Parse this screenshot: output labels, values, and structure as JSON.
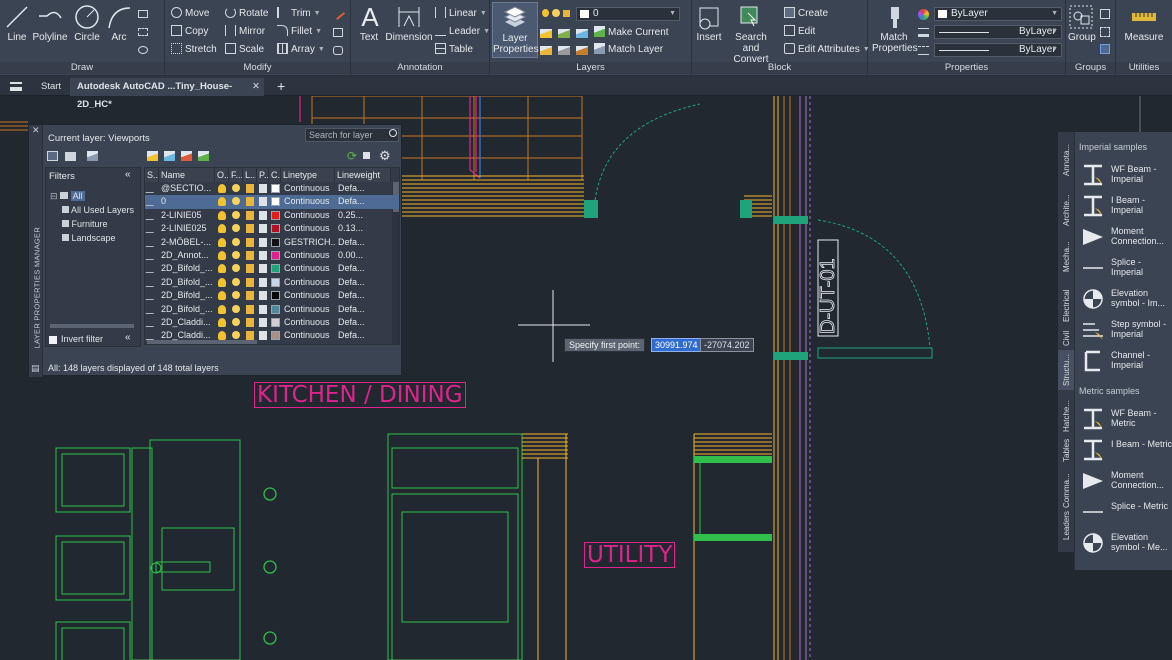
{
  "ribbon": {
    "draw": {
      "label": "Draw",
      "tools": [
        "Line",
        "Polyline",
        "Circle",
        "Arc"
      ]
    },
    "modify": {
      "label": "Modify",
      "tools": [
        "Move",
        "Rotate",
        "Trim",
        "Copy",
        "Mirror",
        "Fillet",
        "Stretch",
        "Scale",
        "Array"
      ]
    },
    "annotation": {
      "label": "Annotation",
      "big": [
        "Text",
        "Dimension"
      ],
      "tools": [
        "Linear",
        "Leader",
        "Table"
      ]
    },
    "layers": {
      "label": "Layers",
      "big": "Layer Properties",
      "combo_value": "0",
      "tools": [
        "Make Current",
        "Match Layer"
      ]
    },
    "block": {
      "label": "Block",
      "big": [
        "Insert",
        "Search and Convert"
      ],
      "tools": [
        "Create",
        "Edit",
        "Edit Attributes"
      ]
    },
    "properties": {
      "label": "Properties",
      "big": "Match Properties",
      "combos": [
        "ByLayer",
        "ByLayer",
        "ByLayer"
      ]
    },
    "groups": {
      "label": "Groups",
      "big": "Group"
    },
    "utilities": {
      "label": "Utilities",
      "big": "Measure"
    }
  },
  "tabs": [
    "Start",
    "Autodesk AutoCAD ...Tiny_House-2D_HC*"
  ],
  "layer_manager": {
    "side_title": "LAYER PROPERTIES MANAGER",
    "current_layer": "Current layer: Viewports",
    "search_placeholder": "Search for layer",
    "filters_title": "Filters",
    "tree": [
      "All",
      "All Used Layers",
      "Furniture",
      "Landscape"
    ],
    "invert_filter": "Invert filter",
    "status": "All: 148 layers displayed of 148 total layers",
    "columns": [
      "S...",
      "Name",
      "O...",
      "F...",
      "L...",
      "P...",
      "C...",
      "Linetype",
      "Lineweight"
    ],
    "rows": [
      {
        "name": "@SECTIO...",
        "color": "#ffffff",
        "linetype": "Continuous",
        "lineweight": "Defa..."
      },
      {
        "name": "0",
        "color": "#ffffff",
        "linetype": "Continuous",
        "lineweight": "Defa..."
      },
      {
        "name": "2-LINIE05",
        "color": "#e61c1c",
        "linetype": "Continuous",
        "lineweight": "0.25..."
      },
      {
        "name": "2-LINIE025",
        "color": "#b01020",
        "linetype": "Continuous",
        "lineweight": "0.13..."
      },
      {
        "name": "2-MÖBEL-...",
        "color": "#111111",
        "linetype": "GESTRICH...",
        "lineweight": "Defa..."
      },
      {
        "name": "2D_Annot...",
        "color": "#e0238c",
        "linetype": "Continuous",
        "lineweight": "0.00..."
      },
      {
        "name": "2D_Bifold_...",
        "color": "#1fa37a",
        "linetype": "Continuous",
        "lineweight": "Defa..."
      },
      {
        "name": "2D_Bifold_...",
        "color": "#c8d8e8",
        "linetype": "Continuous",
        "lineweight": "Defa..."
      },
      {
        "name": "2D_Bifold_...",
        "color": "#0a0a0a",
        "linetype": "Continuous",
        "lineweight": "Defa..."
      },
      {
        "name": "2D_Bifold_...",
        "color": "#4c8a9c",
        "linetype": "Continuous",
        "lineweight": "Defa..."
      },
      {
        "name": "2D_Claddi...",
        "color": "#d0d0d0",
        "linetype": "Continuous",
        "lineweight": "Defa..."
      },
      {
        "name": "2D_Claddi...",
        "color": "#a89088",
        "linetype": "Continuous",
        "lineweight": "Defa..."
      }
    ]
  },
  "palette": {
    "tabs": [
      "Annota...",
      "Archite...",
      "Mecha...",
      "Electrical",
      "Civil",
      "Structu...",
      "Hatche...",
      "Tables",
      "Comma...",
      "Leaders"
    ],
    "imperial_title": "Imperial samples",
    "imperial": [
      "WF Beam - Imperial",
      "I Beam - Imperial",
      "Moment Connection...",
      "Splice - Imperial",
      "Elevation symbol - Im...",
      "Step symbol - Imperial",
      "Channel - Imperial"
    ],
    "metric_title": "Metric samples",
    "metric": [
      "WF Beam - Metric",
      "I Beam - Metric",
      "Moment Connection...",
      "Splice - Metric",
      "Elevation symbol - Me..."
    ]
  },
  "drawing": {
    "labels": [
      "KITCHEN / DINING",
      "UTILITY"
    ],
    "door_tag": "D-UT-01",
    "prompt": "Specify first point:",
    "coord_x": "30991.974",
    "coord_y": "-27074.202"
  }
}
